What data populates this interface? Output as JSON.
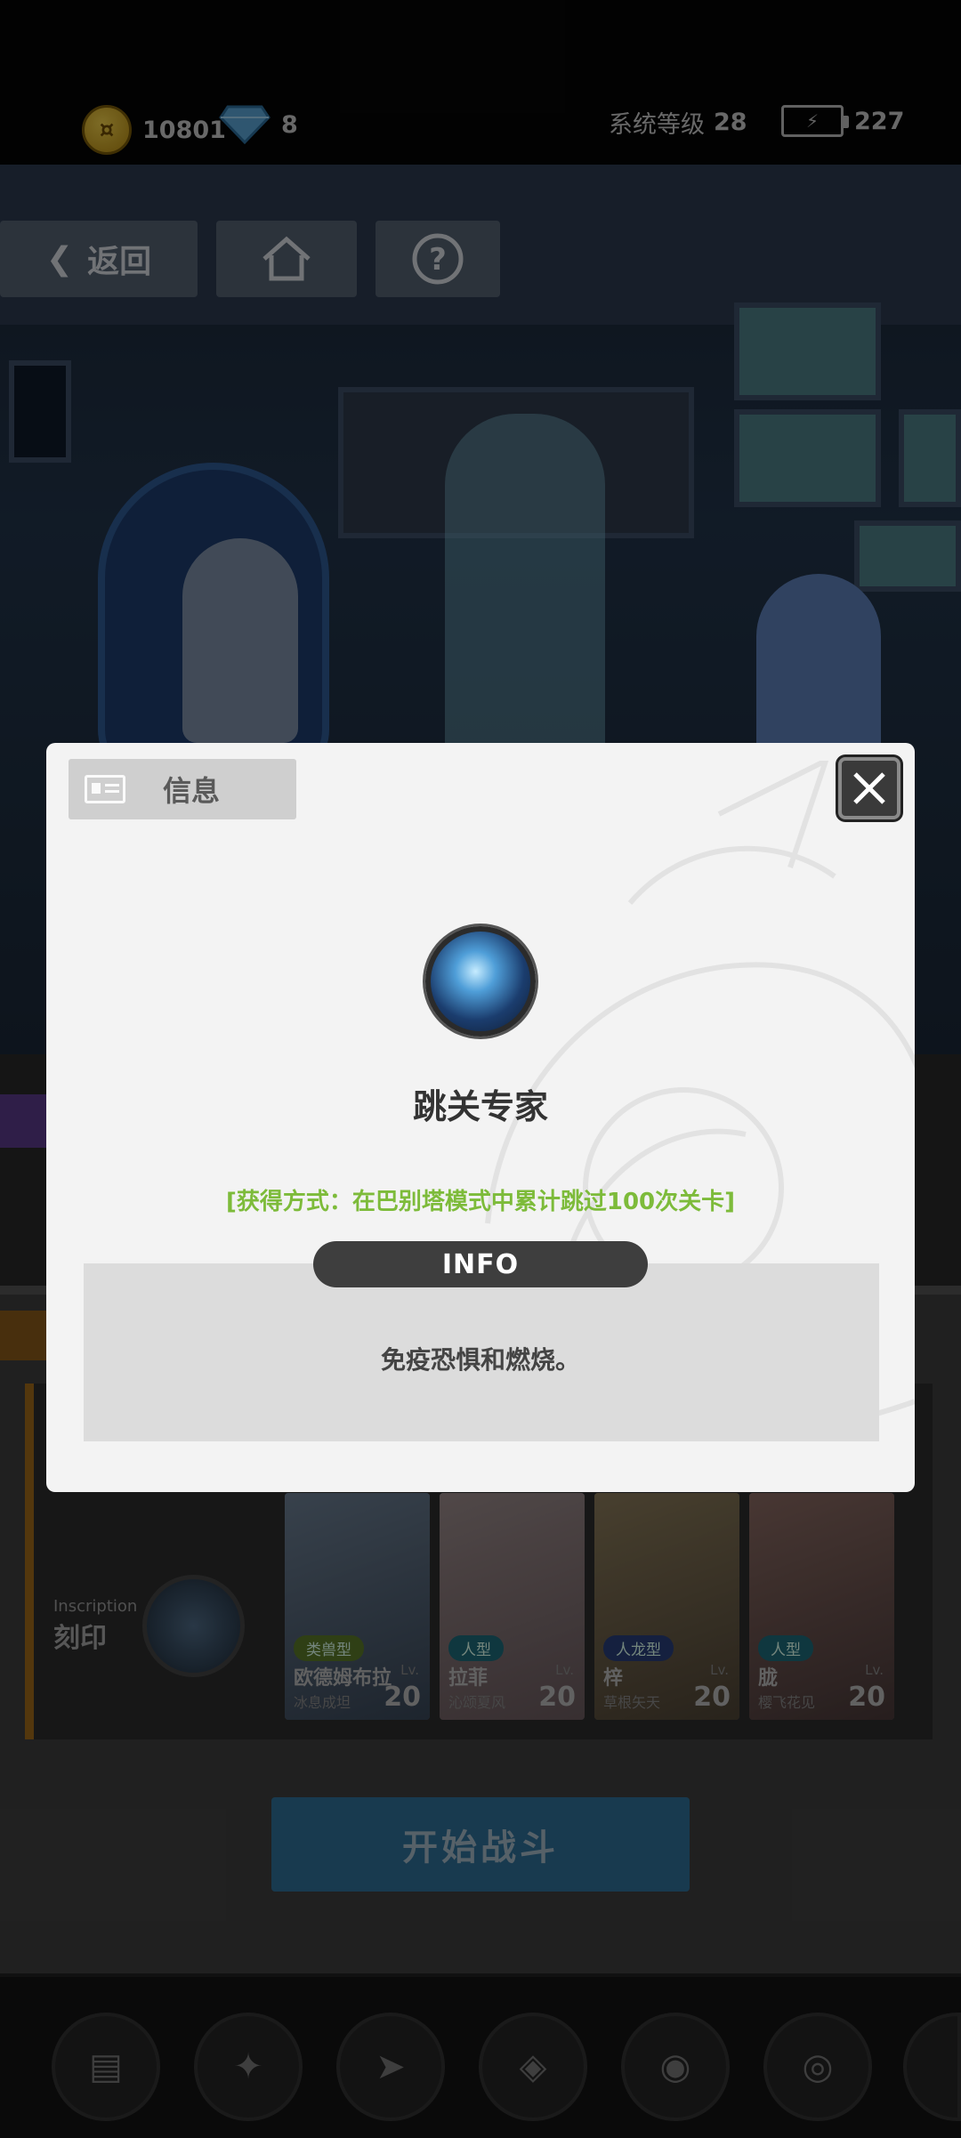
{
  "topbar": {
    "gold": "10801",
    "diamond": "8",
    "system_level_label": "系统等级",
    "system_level": "28",
    "energy": "227"
  },
  "nav": {
    "back_label": "返回"
  },
  "team": {
    "inscription_en": "Inscription",
    "inscription_cn": "刻印",
    "cards": [
      {
        "type": "类兽型",
        "name": "欧德姆布拉",
        "sub": "冰息成坦",
        "lv_label": "Lv.",
        "level": "20",
        "type_color": "#5a7a2a"
      },
      {
        "type": "人型",
        "name": "拉菲",
        "sub": "沁颂夏风",
        "lv_label": "Lv.",
        "level": "20",
        "type_color": "#1e6a7a"
      },
      {
        "type": "人龙型",
        "name": "梓",
        "sub": "草根矢天",
        "lv_label": "Lv.",
        "level": "20",
        "type_color": "#2a3f7a"
      },
      {
        "type": "人型",
        "name": "胧",
        "sub": "樱飞花见",
        "lv_label": "Lv.",
        "level": "20",
        "type_color": "#1e6a7a"
      }
    ]
  },
  "start_button": "开始战斗",
  "dialog": {
    "tag_label": "信息",
    "title": "跳关专家",
    "obtain_text": "[获得方式：在巴别塔模式中累计跳过100次关卡]",
    "info_label": "INFO",
    "effect_text": "免疫恐惧和燃烧。"
  },
  "colors": {
    "obtain": "#7dbb3a",
    "dialog_bg": "#f3f3f3"
  }
}
